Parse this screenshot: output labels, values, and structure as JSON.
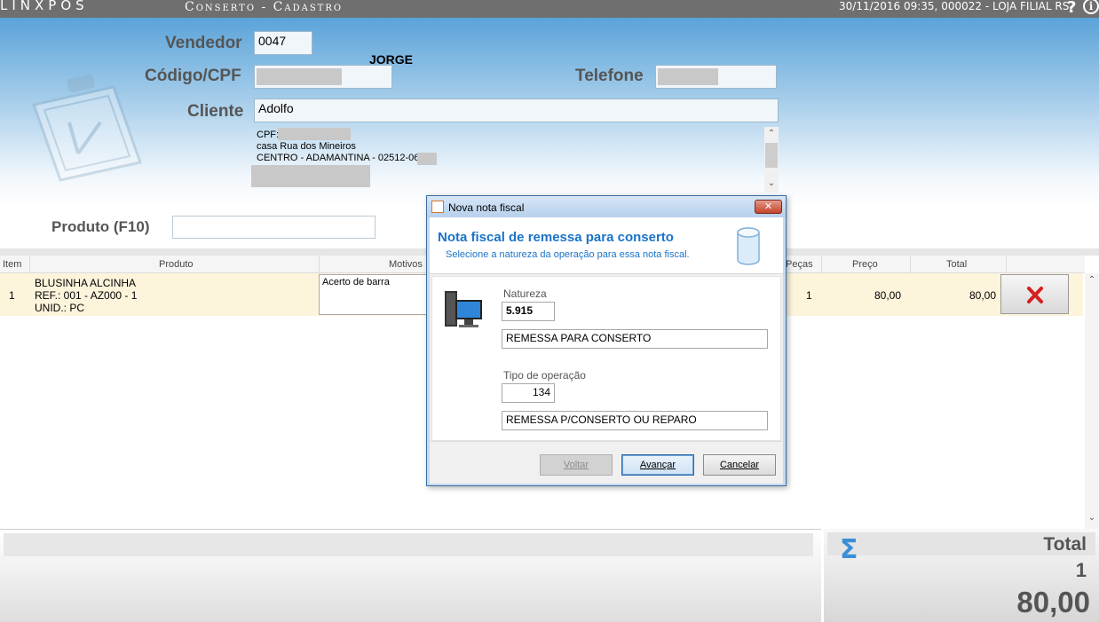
{
  "topbar": {
    "logo": "LINXPOS",
    "title": "Conserto - Cadastro",
    "info": "30/11/2016 09:35, 000022 - LOJA FILIAL RS.",
    "help": "?",
    "info_icon": "i"
  },
  "form": {
    "vendedor_label": "Vendedor",
    "vendedor_code": "0047",
    "vendedor_name": "JORGE",
    "codigo_label": "Código/CPF",
    "telefone_label": "Telefone",
    "cliente_label": "Cliente",
    "cliente_value": "Adolfo",
    "address": {
      "line1": "CPF:",
      "line2": "casa Rua dos Mineiros",
      "line3": "CENTRO - ADAMANTINA - 02512-060"
    }
  },
  "produto": {
    "label": "Produto (F10)",
    "placeholder": ""
  },
  "grid": {
    "headers": {
      "item": "Item",
      "produto": "Produto",
      "motivos": "Motivos",
      "pecas": "Peças",
      "preco": "Preço",
      "total": "Total"
    },
    "rows": [
      {
        "item": "1",
        "desc1": "BLUSINHA ALCINHA",
        "desc2": "REF.: 001 - AZ000 - 1",
        "desc3": "UNID.: PC",
        "motivo": "Acerto de barra",
        "pecas": "1",
        "preco": "80,00",
        "total": "80,00"
      }
    ]
  },
  "totals": {
    "label": "Total",
    "qty": "1",
    "value": "80,00"
  },
  "dialog": {
    "title": "Nova nota fiscal",
    "heading": "Nota fiscal de remessa para conserto",
    "subheading": "Selecione a natureza da operação para essa nota fiscal.",
    "natureza_label": "Natureza",
    "natureza_code": "5.915",
    "natureza_desc": "REMESSA PARA CONSERTO",
    "tipo_label": "Tipo de operação",
    "tipo_code": "134",
    "tipo_desc": "REMESSA P/CONSERTO OU REPARO",
    "btn_voltar": "Voltar",
    "btn_avancar": "Avançar",
    "btn_cancelar": "Cancelar"
  },
  "icons": {
    "clipboard": "clipboard-icon",
    "delete": "delete-x-icon",
    "sigma": "sigma-icon",
    "computer": "computer-icon",
    "database": "database-icon"
  },
  "colors": {
    "accent": "#1a73c9",
    "delete": "#d62020",
    "header_top": "#5aa3d9",
    "row_highlight": "#fdf4dc"
  }
}
